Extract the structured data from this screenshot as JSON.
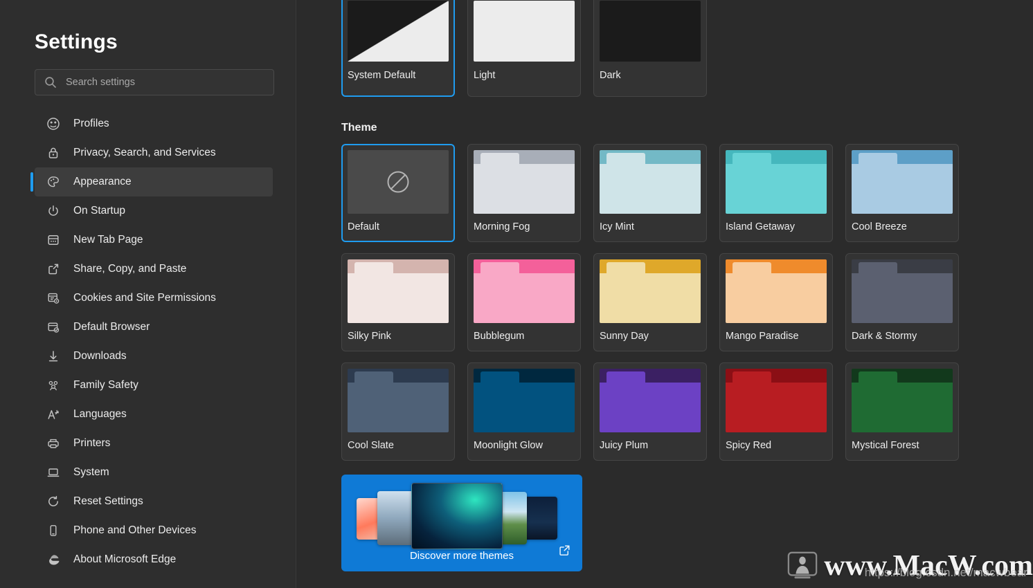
{
  "sidebar": {
    "title": "Settings",
    "search": {
      "placeholder": "Search settings",
      "value": "",
      "icon": "search-icon"
    },
    "items": [
      {
        "label": "Profiles",
        "icon": "profiles-icon",
        "selected": false
      },
      {
        "label": "Privacy, Search, and Services",
        "icon": "lock-icon",
        "selected": false
      },
      {
        "label": "Appearance",
        "icon": "palette-icon",
        "selected": true
      },
      {
        "label": "On Startup",
        "icon": "power-icon",
        "selected": false
      },
      {
        "label": "New Tab Page",
        "icon": "new-tab-icon",
        "selected": false
      },
      {
        "label": "Share, Copy, and Paste",
        "icon": "share-icon",
        "selected": false
      },
      {
        "label": "Cookies and Site Permissions",
        "icon": "cookies-icon",
        "selected": false
      },
      {
        "label": "Default Browser",
        "icon": "default-browser-icon",
        "selected": false
      },
      {
        "label": "Downloads",
        "icon": "download-icon",
        "selected": false
      },
      {
        "label": "Family Safety",
        "icon": "family-icon",
        "selected": false
      },
      {
        "label": "Languages",
        "icon": "languages-icon",
        "selected": false
      },
      {
        "label": "Printers",
        "icon": "printer-icon",
        "selected": false
      },
      {
        "label": "System",
        "icon": "laptop-icon",
        "selected": false
      },
      {
        "label": "Reset Settings",
        "icon": "reset-icon",
        "selected": false
      },
      {
        "label": "Phone and Other Devices",
        "icon": "phone-icon",
        "selected": false
      },
      {
        "label": "About Microsoft Edge",
        "icon": "edge-icon",
        "selected": false
      }
    ]
  },
  "main": {
    "accent_color": "#1f9cf0",
    "appearance_modes": [
      {
        "label": "System Default",
        "preview": "split",
        "selected": true
      },
      {
        "label": "Light",
        "preview": "light",
        "selected": false
      },
      {
        "label": "Dark",
        "preview": "dark",
        "selected": false
      }
    ],
    "theme_section_title": "Theme",
    "themes": [
      [
        {
          "label": "Default",
          "selected": true,
          "strip": "#4a4a4a",
          "body": "#4a4a4a",
          "tab": "#4a4a4a",
          "no_theme": true
        },
        {
          "label": "Morning Fog",
          "selected": false,
          "strip": "#a8aeb8",
          "body": "#dcdfe4",
          "tab": "#dcdfe4"
        },
        {
          "label": "Icy Mint",
          "selected": false,
          "strip": "#73b9c6",
          "body": "#cfe4e8",
          "tab": "#cfe4e8"
        },
        {
          "label": "Island Getaway",
          "selected": false,
          "strip": "#45b7bd",
          "body": "#68d3d6",
          "tab": "#68d3d6"
        },
        {
          "label": "Cool Breeze",
          "selected": false,
          "strip": "#5d9fc7",
          "body": "#a9cbe3",
          "tab": "#a9cbe3"
        }
      ],
      [
        {
          "label": "Silky Pink",
          "selected": false,
          "strip": "#d4b4ae",
          "body": "#f2e6e3",
          "tab": "#f2e6e3"
        },
        {
          "label": "Bubblegum",
          "selected": false,
          "strip": "#f4609a",
          "body": "#f9a8c6",
          "tab": "#f9a8c6"
        },
        {
          "label": "Sunny Day",
          "selected": false,
          "strip": "#dfa82a",
          "body": "#f0dda6",
          "tab": "#f0dda6"
        },
        {
          "label": "Mango Paradise",
          "selected": false,
          "strip": "#ef8b2c",
          "body": "#f8cda0",
          "tab": "#f8cda0"
        },
        {
          "label": "Dark & Stormy",
          "selected": false,
          "strip": "#3a3d45",
          "body": "#5b6070",
          "tab": "#5b6070"
        }
      ],
      [
        {
          "label": "Cool Slate",
          "selected": false,
          "strip": "#2d3b4f",
          "body": "#4f6177",
          "tab": "#4f6177"
        },
        {
          "label": "Moonlight Glow",
          "selected": false,
          "strip": "#00283f",
          "body": "#02527f",
          "tab": "#02527f"
        },
        {
          "label": "Juicy Plum",
          "selected": false,
          "strip": "#3b2063",
          "body": "#6c41c4",
          "tab": "#6c41c4"
        },
        {
          "label": "Spicy Red",
          "selected": false,
          "strip": "#8b0f15",
          "body": "#b81d22",
          "tab": "#b81d22"
        },
        {
          "label": "Mystical Forest",
          "selected": false,
          "strip": "#12391c",
          "body": "#1f6b33",
          "tab": "#1f6b33"
        }
      ]
    ],
    "banner": {
      "label": "Discover more themes",
      "icon": "external-link-icon",
      "background": "#0f7ad6"
    }
  },
  "watermark": {
    "text": "www.MacW.com",
    "subtext": "https://blog.csdn.net/macwbear",
    "logo": "macw-logo-icon"
  }
}
